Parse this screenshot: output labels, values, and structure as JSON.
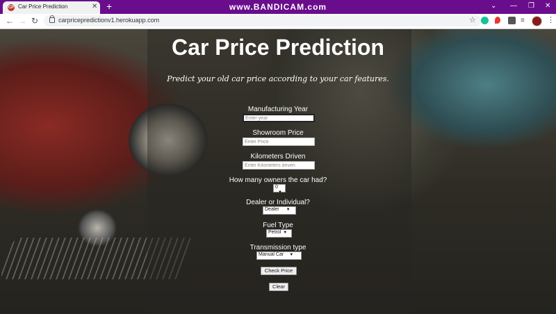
{
  "browser": {
    "tab_title": "Car Price Prediction",
    "tab_favicon_text": "CP",
    "new_tab_glyph": "+",
    "close_glyph": "✕",
    "watermark": "www.BANDICAM.com",
    "url": "carpricepredictionv1.herokuapp.com",
    "window_controls": {
      "tab_list": "⌄",
      "minimize": "—",
      "maximize": "❐",
      "close": "✕"
    },
    "nav": {
      "back": "←",
      "forward": "→",
      "reload": "↻"
    },
    "star_glyph": "☆",
    "extensions_list_glyph": "≡",
    "menu_glyph": "⋮"
  },
  "page": {
    "title": "Car Price Prediction",
    "subtitle": "Predict your old car price according to your car features.",
    "form": {
      "year_label": "Manufacturing Year",
      "year_placeholder": "Enter year",
      "price_label": "Showroom Price",
      "price_placeholder": "Enter Price",
      "km_label": "Kilometers Driven",
      "km_placeholder": "Enter Kilometers driven",
      "owners_label": "How many owners the car had?",
      "owners_value": "0",
      "seller_label": "Dealer or Individual?",
      "seller_value": "Dealer",
      "fuel_label": "Fuel Type",
      "fuel_value": "Petrol",
      "transmission_label": "Transmission type",
      "transmission_value": "Manual Car",
      "check_button": "Check Price",
      "clear_button": "Clear"
    }
  }
}
